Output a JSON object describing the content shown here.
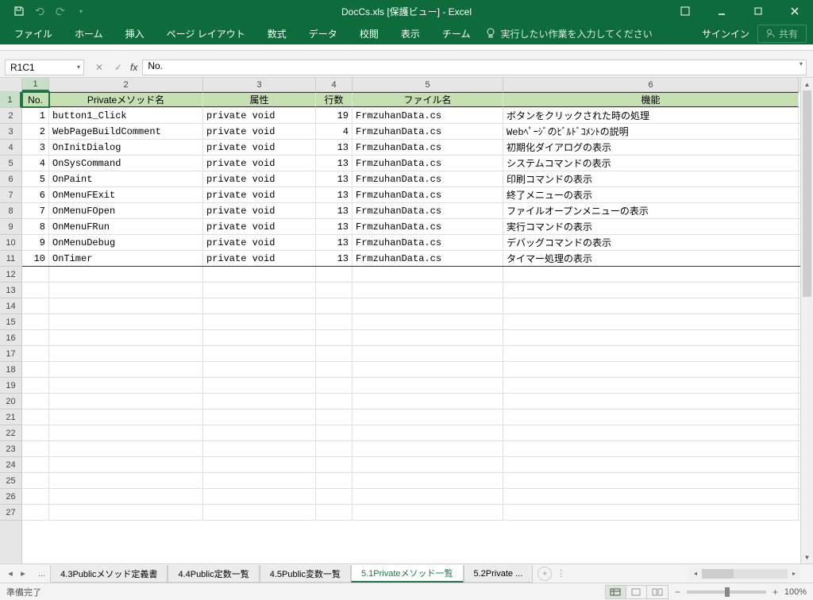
{
  "titlebar": {
    "title": "DocCs.xls  [保護ビュー] - Excel"
  },
  "ribbon": {
    "tabs": [
      "ファイル",
      "ホーム",
      "挿入",
      "ページ レイアウト",
      "数式",
      "データ",
      "校閲",
      "表示",
      "チーム"
    ],
    "tellme": "実行したい作業を入力してください",
    "signin": "サインイン",
    "share": "共有"
  },
  "formula": {
    "namebox": "R1C1",
    "content": "No."
  },
  "columns": [
    "1",
    "2",
    "3",
    "4",
    "5",
    "6"
  ],
  "headers": [
    "No.",
    "Privateメソッド名",
    "属性",
    "行数",
    "ファイル名",
    "機能"
  ],
  "rows": [
    {
      "no": "1",
      "name": "button1_Click",
      "attr": "private void",
      "lines": "19",
      "file": "FrmzuhanData.cs",
      "desc": "ボタンをクリックされた時の処理"
    },
    {
      "no": "2",
      "name": "WebPageBuildComment",
      "attr": "private void",
      "lines": "4",
      "file": "FrmzuhanData.cs",
      "desc": "Webﾍﾟｰｼﾞのﾋﾞﾙﾄﾞｺﾒﾝﾄの説明"
    },
    {
      "no": "3",
      "name": "OnInitDialog",
      "attr": "private void",
      "lines": "13",
      "file": "FrmzuhanData.cs",
      "desc": "初期化ダイアログの表示"
    },
    {
      "no": "4",
      "name": "OnSysCommand",
      "attr": "private void",
      "lines": "13",
      "file": "FrmzuhanData.cs",
      "desc": "システムコマンドの表示"
    },
    {
      "no": "5",
      "name": "OnPaint",
      "attr": "private void",
      "lines": "13",
      "file": "FrmzuhanData.cs",
      "desc": "印刷コマンドの表示"
    },
    {
      "no": "6",
      "name": "OnMenuFExit",
      "attr": "private void",
      "lines": "13",
      "file": "FrmzuhanData.cs",
      "desc": "終了メニューの表示"
    },
    {
      "no": "7",
      "name": "OnMenuFOpen",
      "attr": "private void",
      "lines": "13",
      "file": "FrmzuhanData.cs",
      "desc": "ファイルオープンメニューの表示"
    },
    {
      "no": "8",
      "name": "OnMenuFRun",
      "attr": "private void",
      "lines": "13",
      "file": "FrmzuhanData.cs",
      "desc": "実行コマンドの表示"
    },
    {
      "no": "9",
      "name": "OnMenuDebug",
      "attr": "private void",
      "lines": "13",
      "file": "FrmzuhanData.cs",
      "desc": "デバッグコマンドの表示"
    },
    {
      "no": "10",
      "name": "OnTimer",
      "attr": "private void",
      "lines": "13",
      "file": "FrmzuhanData.cs",
      "desc": "タイマー処理の表示"
    }
  ],
  "emptyRows": 16,
  "sheetTabs": {
    "tabs": [
      "4.3Publicメソッド定義書",
      "4.4Public定数一覧",
      "4.5Public変数一覧",
      "5.1Privateメソッド一覧",
      "5.2Private ..."
    ],
    "active": 3
  },
  "status": {
    "ready": "準備完了",
    "zoom": "100%"
  }
}
